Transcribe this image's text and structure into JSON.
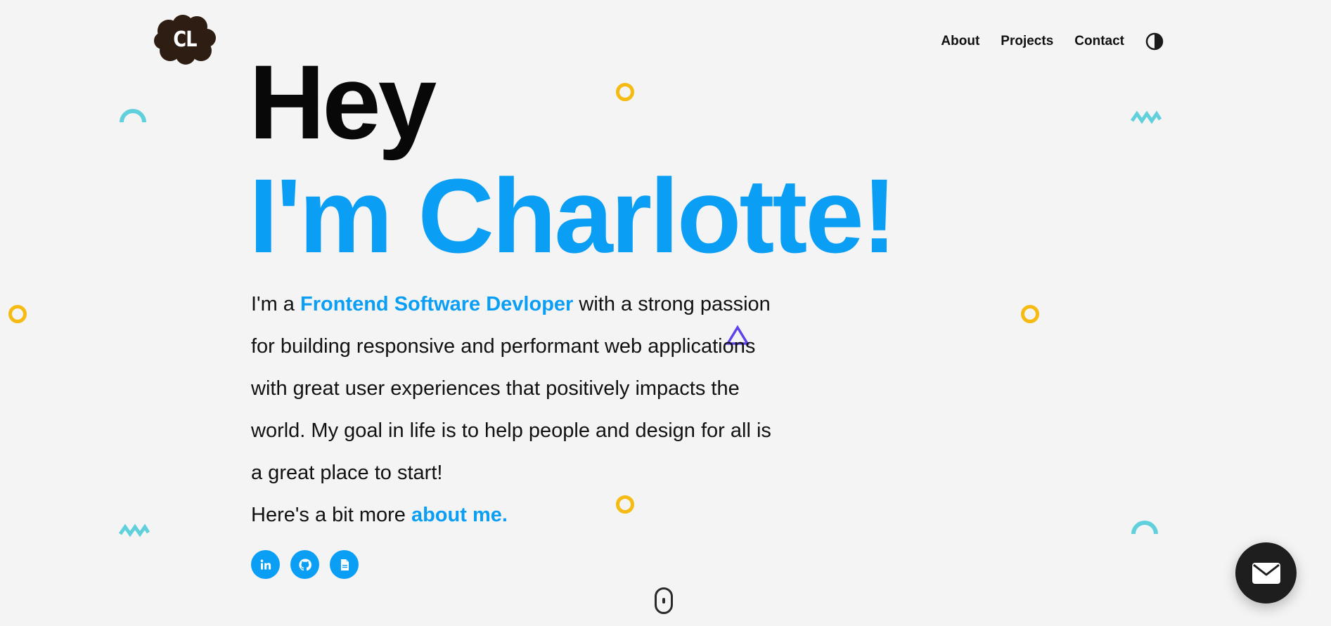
{
  "logo": {
    "initials": "CL"
  },
  "nav": {
    "items": [
      {
        "label": "About"
      },
      {
        "label": "Projects"
      },
      {
        "label": "Contact"
      }
    ],
    "theme_toggle_icon": "half-circle-contrast-icon"
  },
  "hero": {
    "greeting": "Hey",
    "name_line": "I'm Charlotte!",
    "intro_prefix": "I'm a ",
    "intro_highlight": "Frontend Software Devloper",
    "intro_suffix": " with a strong passion for building responsive and performant web applications with great user experiences that positively impacts the world. My goal in life is to help people and design for all is a great place to start!",
    "more_prefix": "Here's a bit more ",
    "more_link": "about me."
  },
  "socials": [
    {
      "name": "linkedin",
      "icon": "linkedin-icon"
    },
    {
      "name": "github",
      "icon": "github-icon"
    },
    {
      "name": "resume",
      "icon": "pdf-file-icon"
    }
  ],
  "colors": {
    "accent": "#0b9ef5",
    "background": "#f4f4f4",
    "logo": "#2e1d12",
    "ring": "#f5bb12",
    "teal": "#5fd0dc",
    "triangle": "#5b43e8",
    "fab": "#1e1e1e"
  },
  "fab": {
    "icon": "mail-icon"
  },
  "scroll_indicator": {
    "icon": "mouse-scroll-icon"
  }
}
